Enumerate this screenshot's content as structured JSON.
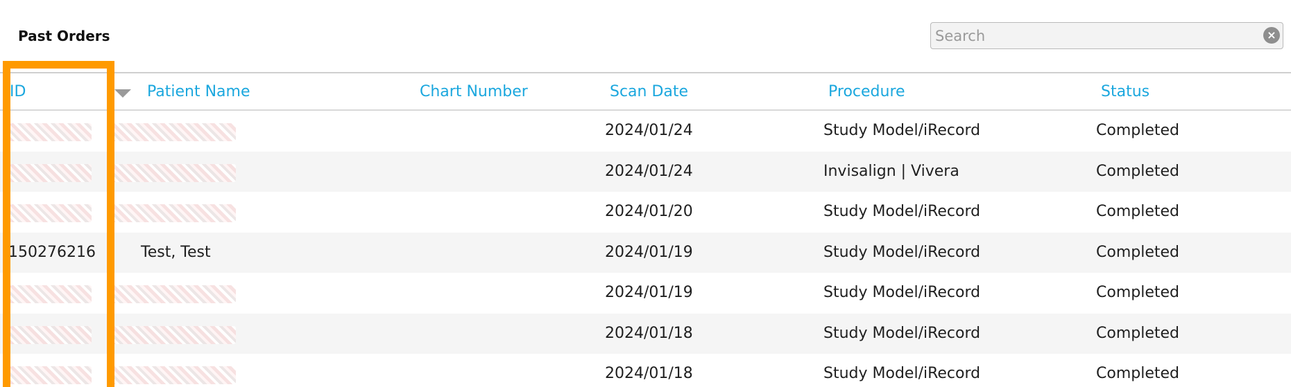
{
  "page_title": "Past Orders",
  "search": {
    "placeholder": "Search",
    "value": "",
    "clear_icon": "clear-circle-icon"
  },
  "table": {
    "columns": {
      "id": "ID",
      "patient_name": "Patient Name",
      "chart_number": "Chart Number",
      "scan_date": "Scan Date",
      "procedure": "Procedure",
      "status": "Status"
    },
    "sort_icon": "sort-descending-icon",
    "rows": [
      {
        "id": "",
        "patient_name": "",
        "chart_number": "",
        "scan_date": "2024/01/24",
        "procedure": "Study Model/iRecord",
        "status": "Completed",
        "redacted": true
      },
      {
        "id": "",
        "patient_name": "",
        "chart_number": "",
        "scan_date": "2024/01/24",
        "procedure": "Invisalign | Vivera",
        "status": "Completed",
        "redacted": true
      },
      {
        "id": "",
        "patient_name": "",
        "chart_number": "",
        "scan_date": "2024/01/20",
        "procedure": "Study Model/iRecord",
        "status": "Completed",
        "redacted": true
      },
      {
        "id": "150276216",
        "patient_name": "Test, Test",
        "chart_number": "",
        "scan_date": "2024/01/19",
        "procedure": "Study Model/iRecord",
        "status": "Completed",
        "redacted": false
      },
      {
        "id": "",
        "patient_name": "",
        "chart_number": "",
        "scan_date": "2024/01/19",
        "procedure": "Study Model/iRecord",
        "status": "Completed",
        "redacted": true
      },
      {
        "id": "",
        "patient_name": "",
        "chart_number": "",
        "scan_date": "2024/01/18",
        "procedure": "Study Model/iRecord",
        "status": "Completed",
        "redacted": true
      },
      {
        "id": "",
        "patient_name": "",
        "chart_number": "",
        "scan_date": "2024/01/18",
        "procedure": "Study Model/iRecord",
        "status": "Completed",
        "redacted": true
      }
    ]
  },
  "colors": {
    "header_text": "#1ba7de",
    "highlight": "#ff9a00",
    "alt_row": "#f5f5f5"
  }
}
